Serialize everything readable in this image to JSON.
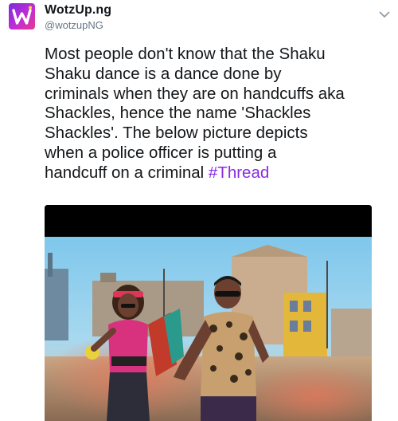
{
  "tweet": {
    "display_name": "WotzUp.ng",
    "handle": "@wotzupNG",
    "avatar_icon": "wotzup-logo-icon",
    "menu_icon": "chevron-down-icon",
    "text_main": "Most people don't know that the Shaku\nShaku dance is a dance done by\ncriminals when they are on handcuffs aka\nShackles, hence the name 'Shackles\nShackles'. The below picture depicts\nwhen a police officer is putting a\nhandcuff on a criminal ",
    "hashtag": "#Thread",
    "accent_color": "#8a2be2"
  },
  "media": {
    "type": "photo"
  }
}
